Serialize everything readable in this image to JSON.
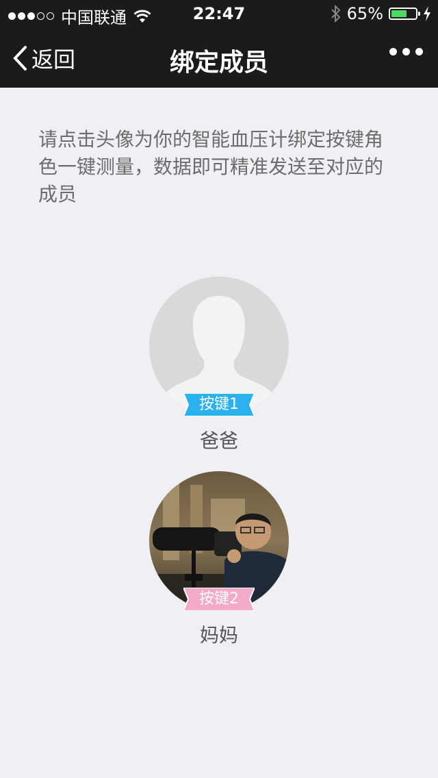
{
  "status_bar": {
    "carrier": "中国联通",
    "time": "22:47",
    "battery_percent": "65%",
    "battery_level": 0.65
  },
  "nav": {
    "back_label": "返回",
    "title": "绑定成员"
  },
  "description": "请点击头像为你的智能血压计绑定按键角色一键测量，数据即可精准发送至对应的成员",
  "members": [
    {
      "tag": "按键1",
      "name": "爸爸",
      "tag_color": "#2bb0f0",
      "avatar": "default-silhouette"
    },
    {
      "tag": "按键2",
      "name": "妈妈",
      "tag_color": "#f4a9c9",
      "avatar": "photo-man-with-camera"
    }
  ],
  "colors": {
    "navbar_bg": "#1b1b1d",
    "page_bg": "#efeff4",
    "battery_fill": "#4cd964"
  }
}
